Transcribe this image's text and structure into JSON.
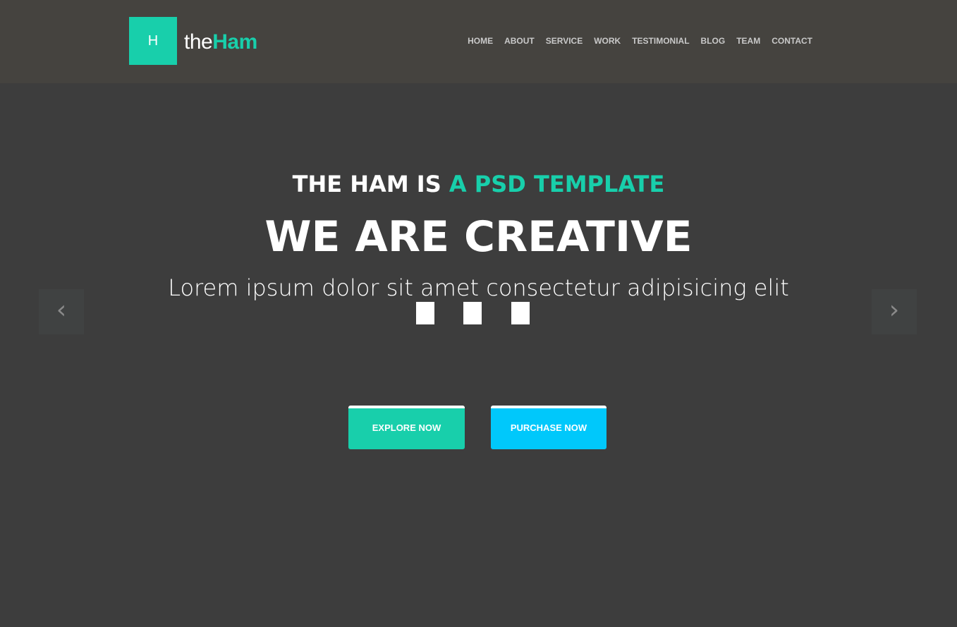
{
  "header": {
    "logo_letter": "H",
    "logo_pre": "the",
    "logo_post": "Ham",
    "nav": [
      "HOME",
      "ABOUT",
      "SERVICE",
      "WORK",
      "TESTIMONIAL",
      "BLOG",
      "TEAM",
      "CONTACT"
    ]
  },
  "hero": {
    "subtitle_white": "THE HAM IS",
    "subtitle_accent": "A PSD TEMPLATE",
    "title": "WE ARE CREATIVE",
    "description": "Lorem ipsum dolor sit amet consectetur adipisicing elit",
    "prev_arrow": "‹",
    "next_arrow": "›",
    "slide_count": 3
  },
  "buttons": {
    "explore": "EXPLORE NOW",
    "purchase": "PURCHASE NOW"
  },
  "colors": {
    "accent": "#18cfab",
    "secondary": "#00c8fb",
    "header_bg": "#45433f",
    "page_bg": "#3d3d3d"
  }
}
